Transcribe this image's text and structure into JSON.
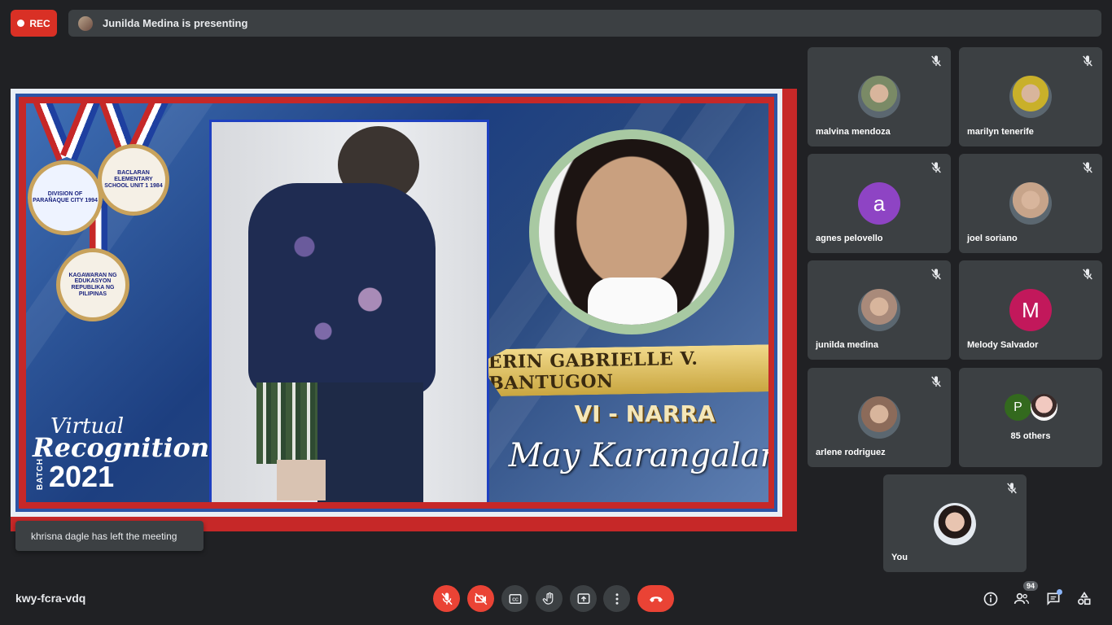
{
  "recording": {
    "label": "REC"
  },
  "presenting": {
    "text": "Junilda Medina is presenting"
  },
  "slide": {
    "student_name": "ERIN GABRIELLE V. BANTUGON",
    "section": "VI - NARRA",
    "award": "May Karangalan",
    "virtual": "Virtual",
    "recognition": "Recognition",
    "batch": "BATCH",
    "year": "2021",
    "medal_1": "DIVISION OF PARAÑAQUE CITY 1994",
    "medal_2": "BACLARAN ELEMENTARY SCHOOL UNIT 1 1984",
    "medal_3": "KAGAWARAN NG EDUKASYON REPUBLIKA NG PILIPINAS"
  },
  "toast": {
    "text": "khrisna dagle has left the meeting"
  },
  "participants": [
    {
      "name": "malvina mendoza",
      "avatar": "photo",
      "color": "#7a8a66"
    },
    {
      "name": "marilyn tenerife",
      "avatar": "photo",
      "color": "#c9b02a"
    },
    {
      "name": "agnes pelovello",
      "avatar": "letter",
      "letter": "a",
      "color": "#8e44c4"
    },
    {
      "name": "joel soriano",
      "avatar": "photo",
      "color": "#c7a48a"
    },
    {
      "name": "junilda medina",
      "avatar": "photo",
      "color": "#a98a7a"
    },
    {
      "name": "Melody Salvador",
      "avatar": "letter",
      "letter": "M",
      "color": "#c2185b"
    },
    {
      "name": "arlene rodriguez",
      "avatar": "photo",
      "color": "#8c6b5a"
    }
  ],
  "others": {
    "letter": "P",
    "color": "#33691e",
    "label": "85 others"
  },
  "self": {
    "name": "You"
  },
  "meeting_code": "kwy-fcra-vdq",
  "people_count": "94",
  "colors": {
    "background": "#202124",
    "tile": "#3c4043",
    "danger": "#ea4335"
  }
}
